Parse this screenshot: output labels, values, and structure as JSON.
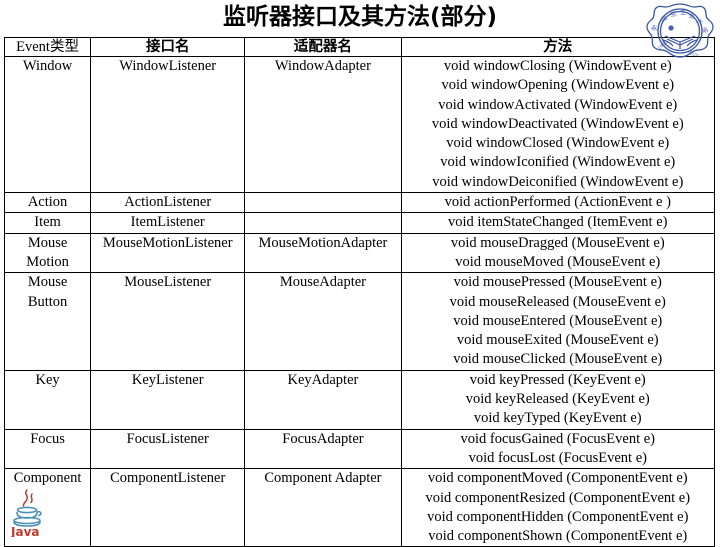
{
  "slide": {
    "title": "监听器接口及其方法(部分)",
    "seal_color": "#3b55a8",
    "java_logo_text": "Java"
  },
  "table": {
    "headers": [
      "Event类型",
      "接口名",
      "适配器名",
      "方法"
    ],
    "rows": [
      {
        "event": "Window",
        "listener": "WindowListener",
        "adapter": "WindowAdapter",
        "methods": [
          "void windowClosing (WindowEvent e)",
          "void windowOpening (WindowEvent e)",
          "void windowActivated (WindowEvent e)",
          "void windowDeactivated (WindowEvent e)",
          "void windowClosed (WindowEvent e)",
          "void windowIconified (WindowEvent e)",
          "void windowDeiconified (WindowEvent e)"
        ]
      },
      {
        "event": "Action",
        "listener": "ActionListener",
        "adapter": "",
        "methods": [
          "void actionPerformed (ActionEvent e )"
        ]
      },
      {
        "event": "Item",
        "listener": "ItemListener",
        "adapter": "",
        "methods": [
          "void itemStateChanged (ItemEvent e)"
        ]
      },
      {
        "event": "Mouse Motion",
        "listener": "MouseMotionListener",
        "adapter": "MouseMotionAdapter",
        "methods": [
          "void mouseDragged (MouseEvent e)",
          "void mouseMoved (MouseEvent e)"
        ]
      },
      {
        "event": "Mouse Button",
        "listener": "MouseListener",
        "adapter": "MouseAdapter",
        "methods": [
          "void mousePressed (MouseEvent e)",
          "void mouseReleased (MouseEvent e)",
          "void mouseEntered (MouseEvent e)",
          "void mouseExited (MouseEvent e)",
          "void mouseClicked (MouseEvent e)"
        ]
      },
      {
        "event": "Key",
        "listener": "KeyListener",
        "adapter": "KeyAdapter",
        "methods": [
          "void keyPressed (KeyEvent e)",
          "void keyReleased (KeyEvent e)",
          "void keyTyped (KeyEvent e)"
        ]
      },
      {
        "event": "Focus",
        "listener": "FocusListener",
        "adapter": "FocusAdapter",
        "methods": [
          "void focusGained (FocusEvent e)",
          "void focusLost (FocusEvent e)"
        ]
      },
      {
        "event": "Component",
        "listener": "ComponentListener",
        "adapter": "Component Adapter",
        "methods": [
          "void componentMoved (ComponentEvent e)",
          "void componentResized (ComponentEvent e)",
          "void componentHidden (ComponentEvent e)",
          "void componentShown (ComponentEvent e)"
        ]
      }
    ]
  }
}
